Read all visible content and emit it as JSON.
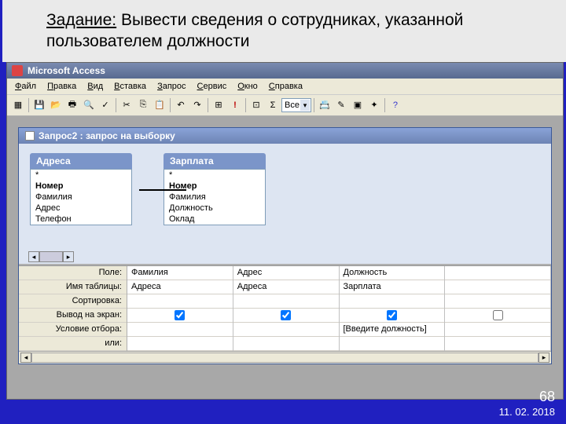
{
  "task": {
    "label": "Задание:",
    "text": " Вывести сведения о сотрудниках, указанной пользователем должности"
  },
  "app": {
    "title": "Microsoft Access"
  },
  "menu": {
    "m0": "Файл",
    "m1": "Правка",
    "m2": "Вид",
    "m3": "Вставка",
    "m4": "Запрос",
    "m5": "Сервис",
    "m6": "Окно",
    "m7": "Справка"
  },
  "toolbar": {
    "combo": "Все"
  },
  "query": {
    "title": "Запрос2 : запрос на выборку"
  },
  "tables": {
    "t0": {
      "caption": "Адреса",
      "f0": "*",
      "f1": "Номер",
      "f2": "Фамилия",
      "f3": "Адрес",
      "f4": "Телефон"
    },
    "t1": {
      "caption": "Зарплата",
      "f0": "*",
      "f1": "Номер",
      "f2": "Фамилия",
      "f3": "Должность",
      "f4": "Оклад"
    }
  },
  "grid": {
    "labels": {
      "r0": "Поле:",
      "r1": "Имя таблицы:",
      "r2": "Сортировка:",
      "r3": "Вывод на экран:",
      "r4": "Условие отбора:",
      "r5": "или:"
    },
    "c0": {
      "field": "Фамилия",
      "table": "Адреса",
      "sort": "",
      "show": true,
      "cond": "",
      "or": ""
    },
    "c1": {
      "field": "Адрес",
      "table": "Адреса",
      "sort": "",
      "show": true,
      "cond": "",
      "or": ""
    },
    "c2": {
      "field": "Должность",
      "table": "Зарплата",
      "sort": "",
      "show": true,
      "cond": "[Введите должность]",
      "or": ""
    },
    "c3": {
      "field": "",
      "table": "",
      "sort": "",
      "show": false,
      "cond": "",
      "or": ""
    }
  },
  "footer": {
    "page": "68",
    "date": "11. 02. 2018"
  }
}
